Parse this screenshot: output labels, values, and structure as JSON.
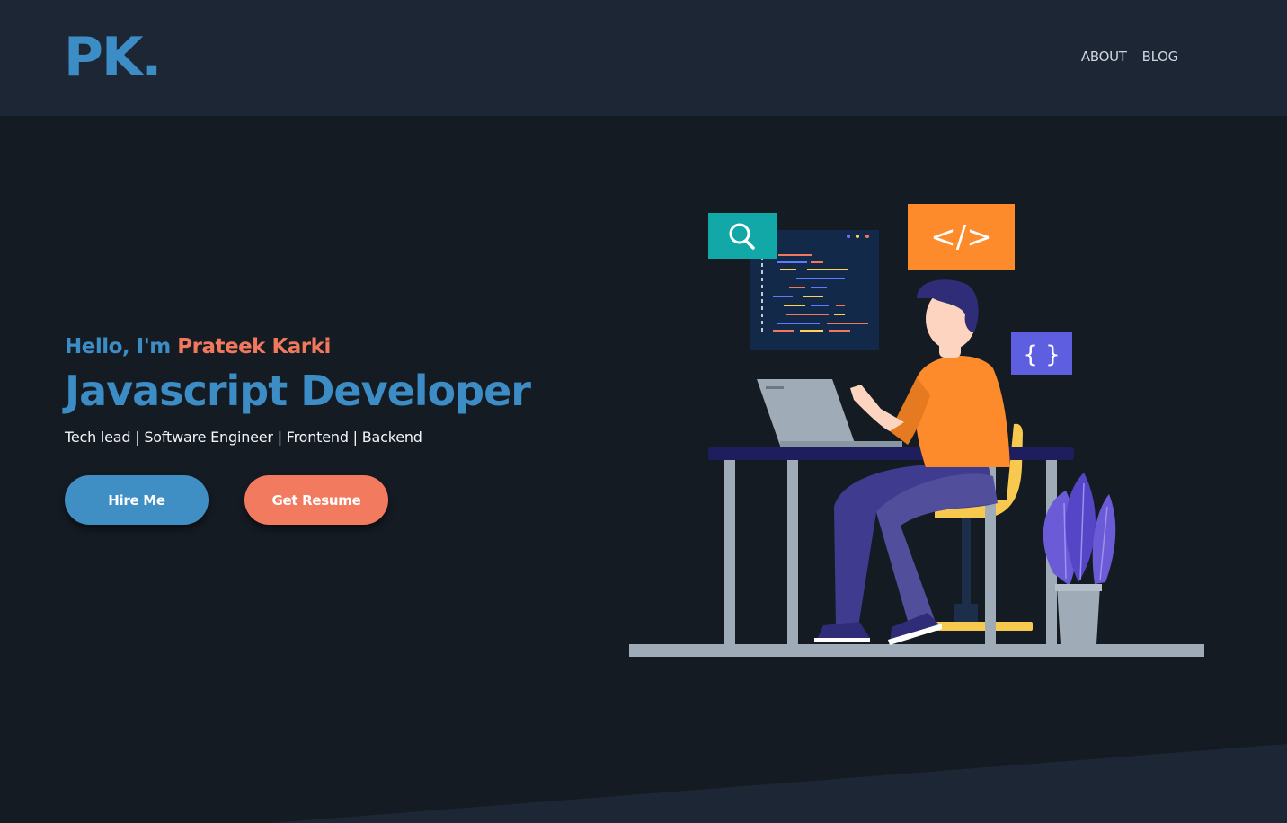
{
  "brand": {
    "logo": "PK."
  },
  "nav": {
    "items": [
      {
        "label": "ABOUT"
      },
      {
        "label": "BLOG"
      }
    ]
  },
  "hero": {
    "greeting": "Hello, I'm",
    "name": "Prateek Karki",
    "role": "Javascript Developer",
    "tagline": "Tech lead | Software Engineer | Frontend | Backend",
    "primary_button": "Hire Me",
    "secondary_button": "Get Resume"
  },
  "illustration": {
    "code_tag": "</>",
    "braces": "{ }",
    "icons": [
      "search-icon",
      "code-window-icon",
      "code-tag-icon",
      "curly-braces-icon",
      "plant-icon"
    ]
  },
  "colors": {
    "background": "#151b23",
    "header": "#1d2634",
    "accent_blue": "#3c8dc5",
    "accent_coral": "#f27a5f",
    "orange": "#fd8a2b",
    "teal": "#12a8a8",
    "purple": "#5d5ee0"
  }
}
